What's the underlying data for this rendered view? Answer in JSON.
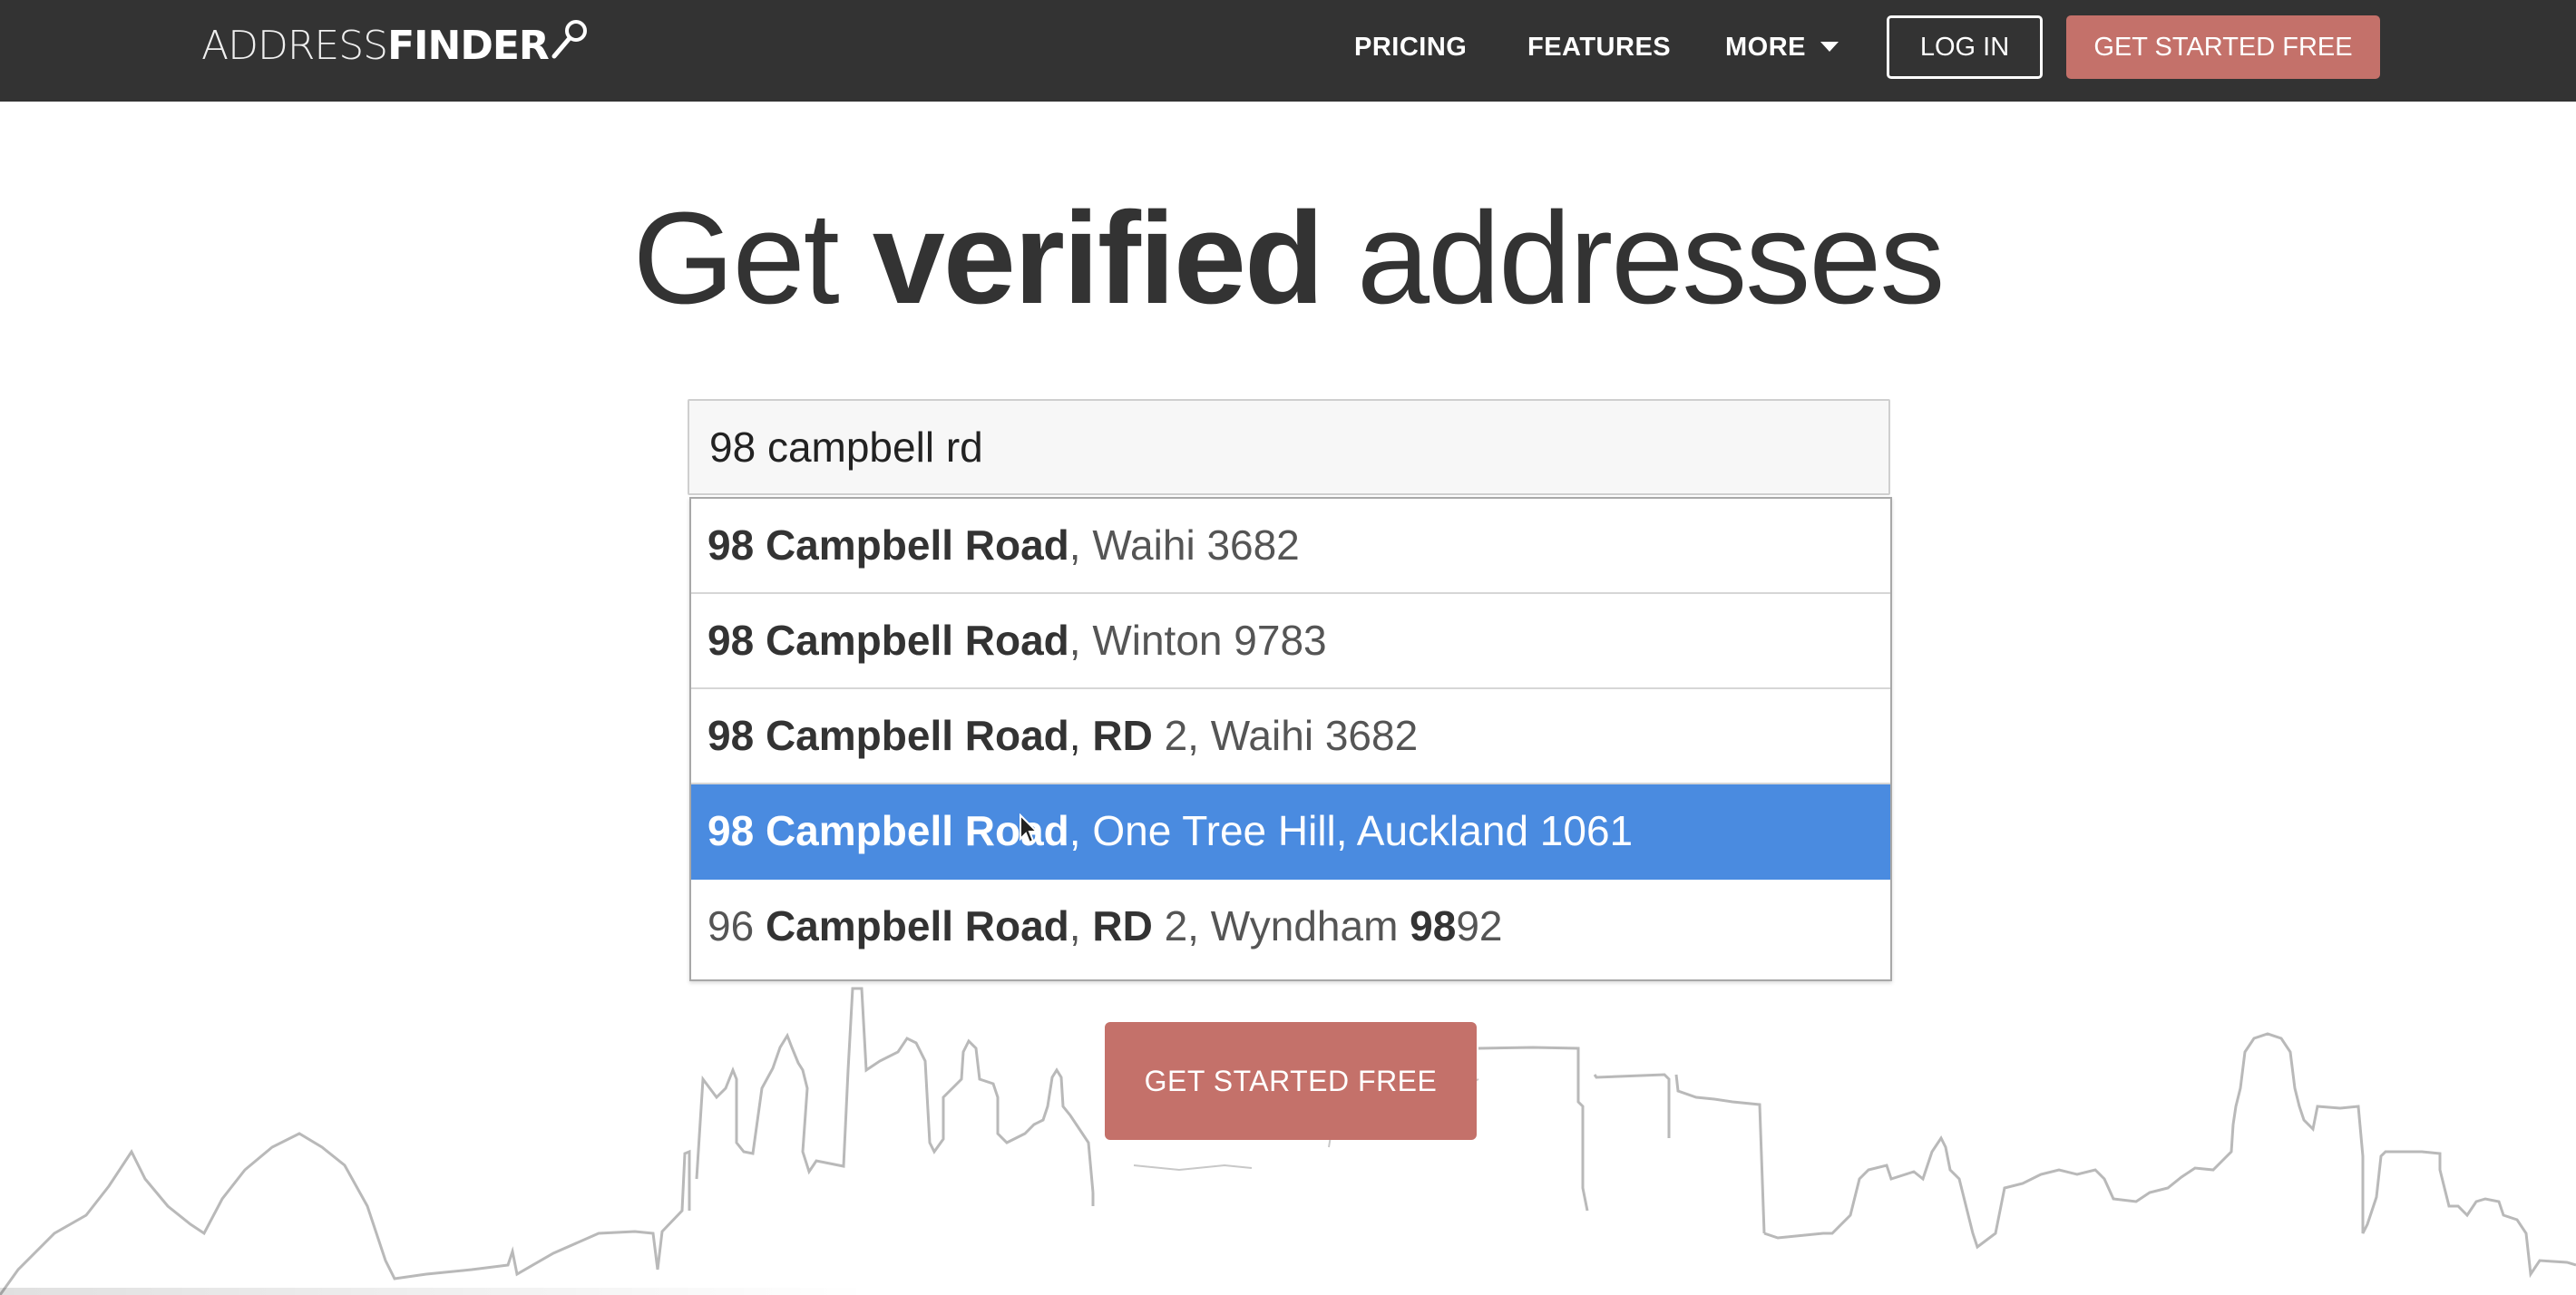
{
  "nav": {
    "logo_thin": "ADDRESS",
    "logo_bold": "FINDER",
    "pricing": "PRICING",
    "features": "FEATURES",
    "more": "MORE",
    "login": "LOG IN",
    "get_started": "GET STARTED FREE"
  },
  "hero": {
    "headline_part1": "Get ",
    "headline_bold": "verified",
    "headline_part2": " addresses"
  },
  "search": {
    "value": "98 campbell rd"
  },
  "suggestions": [
    {
      "num": "98",
      "street": "Campbell Road",
      "rest": ", Waihi 3682"
    },
    {
      "num": "98",
      "street": "Campbell Road",
      "rest": ", Winton 9783"
    },
    {
      "num": "98",
      "street": "Campbell Road",
      "sep": ", ",
      "rd": "RD",
      "rest": " 2, Waihi 3682"
    },
    {
      "num": "98",
      "street": "Campbell Road",
      "rest": ", One Tree Hill, Auckland 1061",
      "selected": true
    },
    {
      "num": "96",
      "street": "Campbell Road",
      "sep": ", ",
      "rd": "RD",
      "rest": " 2, Wyndham ",
      "post_bold": "98",
      "post_rest": "92"
    }
  ],
  "cta": {
    "label": "GET STARTED FREE"
  },
  "colors": {
    "nav_bg": "#333333",
    "accent": "#c4716a",
    "selected": "#4a8be0"
  }
}
